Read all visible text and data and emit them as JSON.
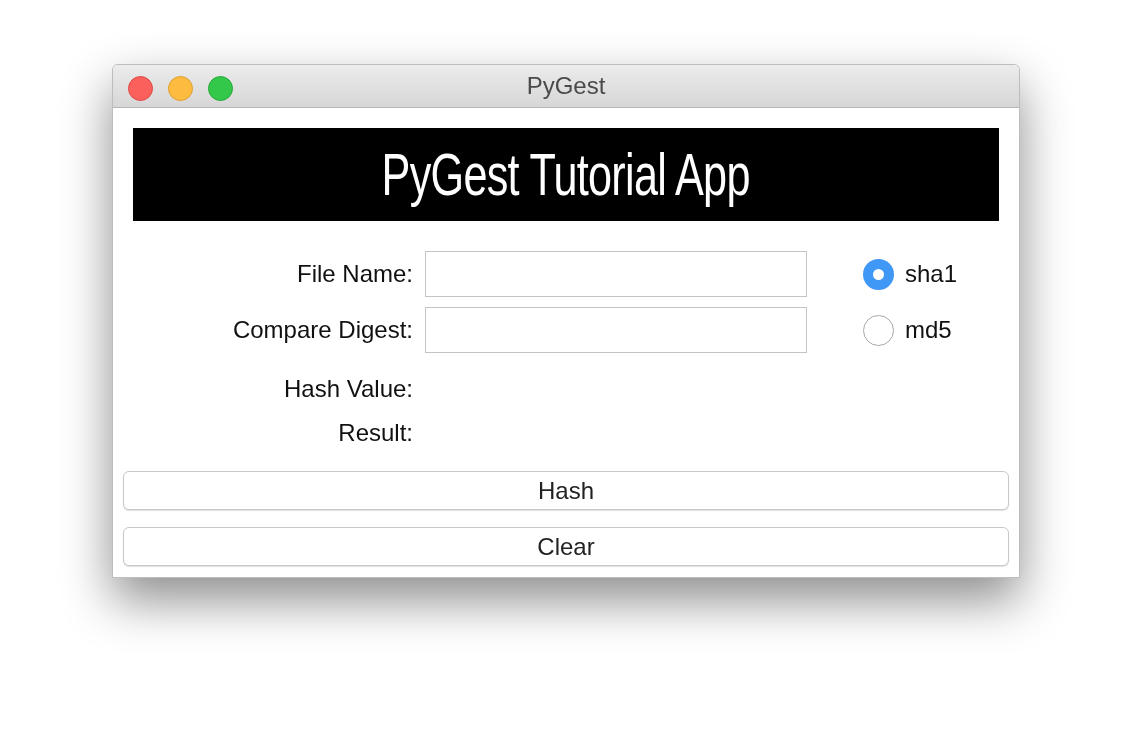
{
  "window": {
    "title": "PyGest"
  },
  "banner": {
    "text": "PyGest Tutorial App"
  },
  "fields": [
    {
      "label": "File Name:"
    },
    {
      "label": "Compare Digest:"
    }
  ],
  "radios": [
    {
      "label": "sha1",
      "selected": true
    },
    {
      "label": "md5",
      "selected": false
    }
  ],
  "outputs": [
    {
      "label": "Hash Value:"
    },
    {
      "label": "Result:"
    }
  ],
  "buttons": [
    "Hash",
    "Clear"
  ]
}
